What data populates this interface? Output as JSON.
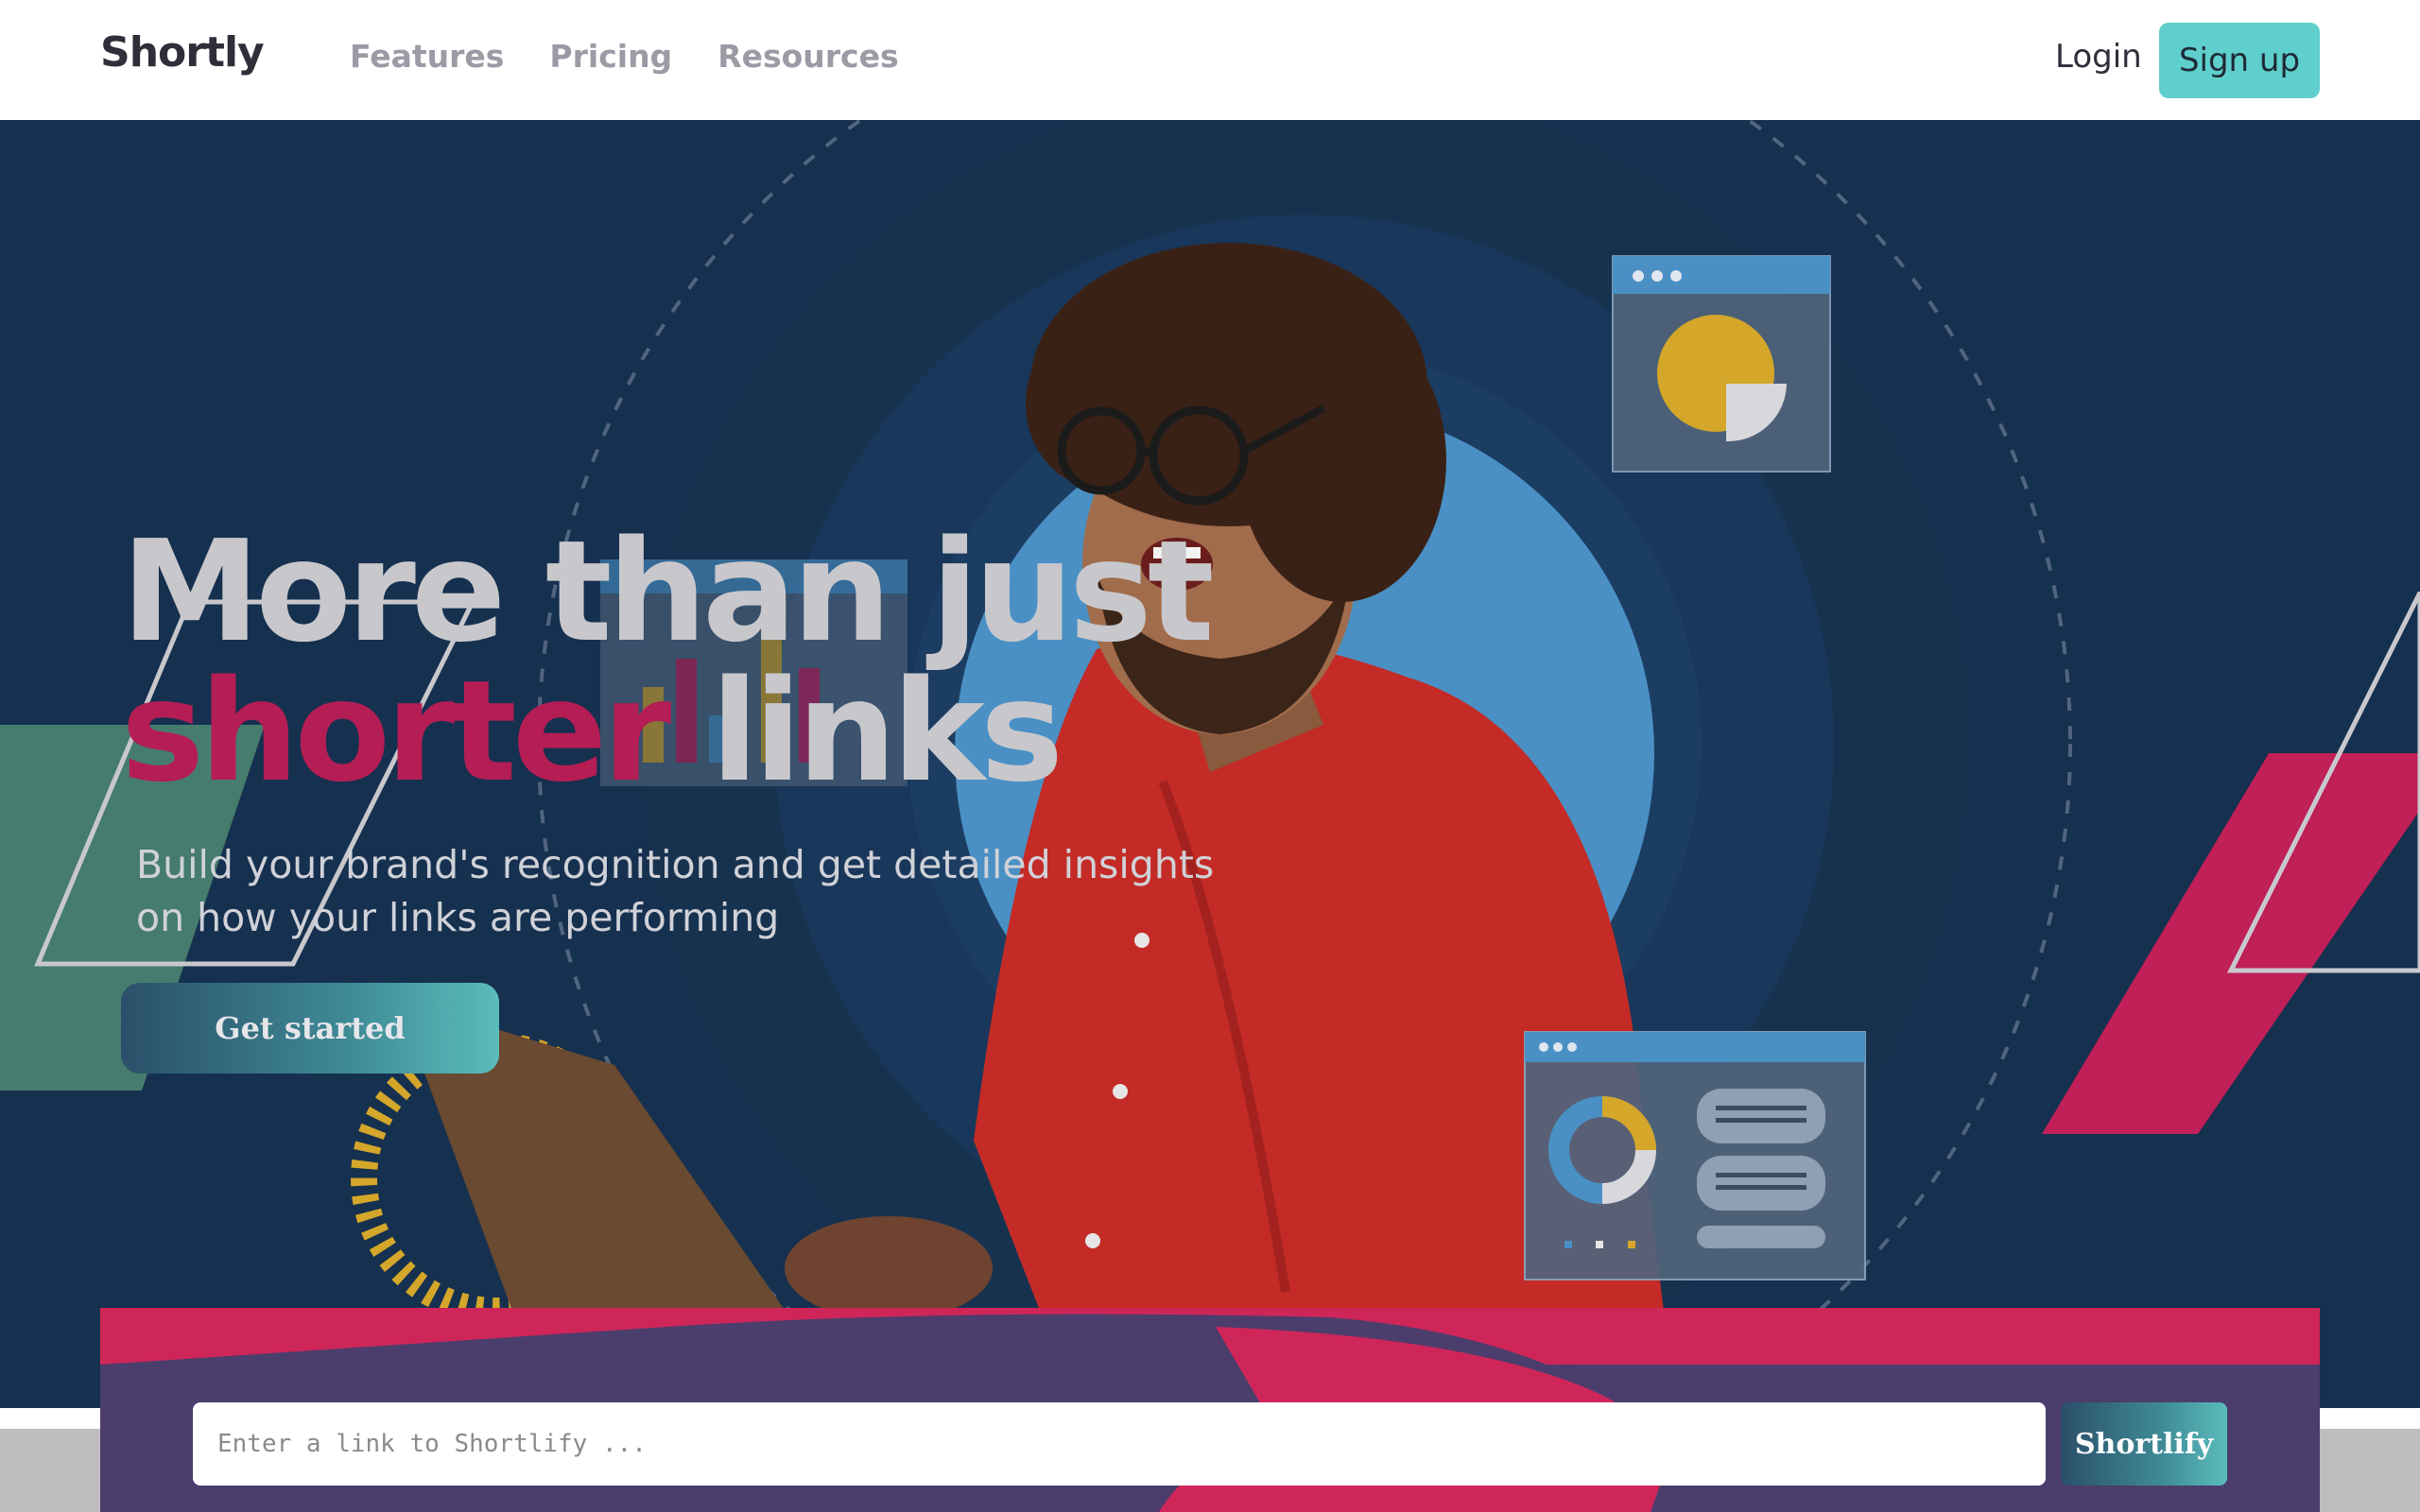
{
  "navbar": {
    "logo": "Shortly",
    "links": [
      "Features",
      "Pricing",
      "Resources"
    ],
    "login": "Login",
    "signup": "Sign up"
  },
  "hero": {
    "headline_line1": "More than just",
    "headline_accent": "shorter",
    "headline_rest": " links",
    "subtext": "Build your brand's recognition and get detailed insights on how your links are performing",
    "cta": "Get started",
    "illustration": "person-with-laptop"
  },
  "shorten": {
    "placeholder": "Enter a link to Shortlify ...",
    "button": "Shortlify"
  },
  "colors": {
    "hero_bg": "#16304f",
    "accent_pink": "#b51d55",
    "teal": "#5ecfcc",
    "panel_purple": "#4b3d6c",
    "shirt_red": "#c42b26",
    "gold": "#d4a62a",
    "sky_blue": "#4a90c4"
  }
}
